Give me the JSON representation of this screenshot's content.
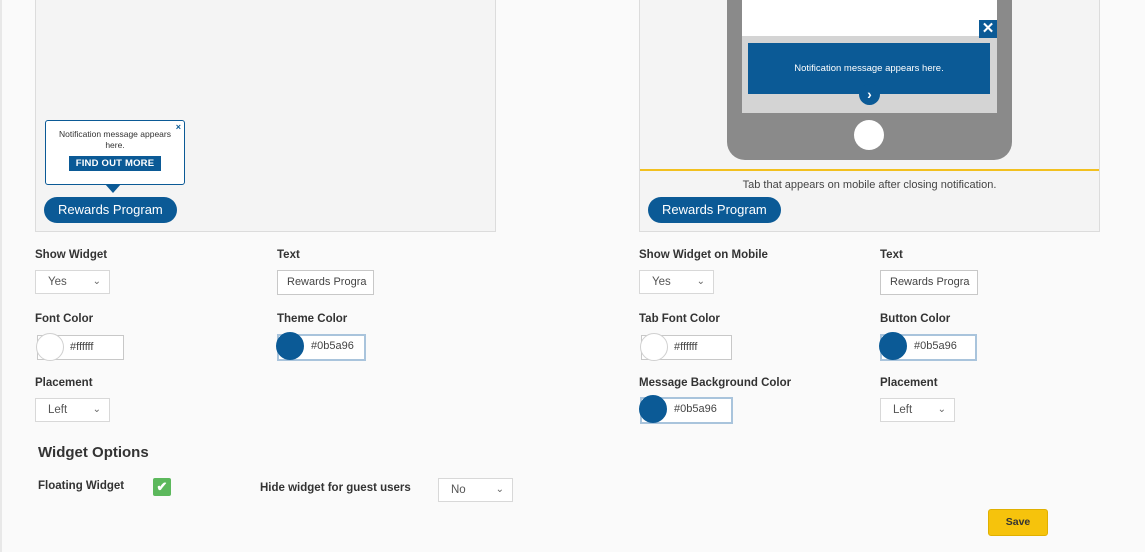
{
  "desktop_preview": {
    "notification_text": "Notification message appears here.",
    "close_glyph": "×",
    "button_label": "FIND OUT MORE",
    "tab_label": "Rewards Program"
  },
  "mobile_preview": {
    "notification_text": "Notification message appears here.",
    "close_glyph": "✕",
    "chevron_glyph": "›",
    "caption": "Tab that appears on mobile after closing notification.",
    "tab_label": "Rewards Program"
  },
  "desktop_settings": {
    "show_widget": {
      "label": "Show Widget",
      "value": "Yes"
    },
    "text": {
      "label": "Text",
      "value": "Rewards Progra"
    },
    "font_color": {
      "label": "Font Color",
      "value": "#ffffff",
      "swatch": "#ffffff"
    },
    "theme_color": {
      "label": "Theme Color",
      "value": "#0b5a96",
      "swatch": "#0b5a96"
    },
    "placement": {
      "label": "Placement",
      "value": "Left"
    }
  },
  "mobile_settings": {
    "show_widget": {
      "label": "Show Widget on Mobile",
      "value": "Yes"
    },
    "text": {
      "label": "Text",
      "value": "Rewards Progra"
    },
    "tab_font_color": {
      "label": "Tab Font Color",
      "value": "#ffffff",
      "swatch": "#ffffff"
    },
    "button_color": {
      "label": "Button Color",
      "value": "#0b5a96",
      "swatch": "#0b5a96"
    },
    "message_bg_color": {
      "label": "Message Background Color",
      "value": "#0b5a96",
      "swatch": "#0b5a96"
    },
    "placement": {
      "label": "Placement",
      "value": "Left"
    }
  },
  "widget_options": {
    "title": "Widget Options",
    "floating_widget": {
      "label": "Floating Widget",
      "checked": true,
      "check_glyph": "✔"
    },
    "hide_for_guests": {
      "label": "Hide widget for guest users",
      "value": "No"
    }
  },
  "save_label": "Save",
  "chevron_glyph": "⌄",
  "colors": {
    "brand": "#0b5a96",
    "accent": "#f6c30c",
    "success": "#5cb85c"
  }
}
